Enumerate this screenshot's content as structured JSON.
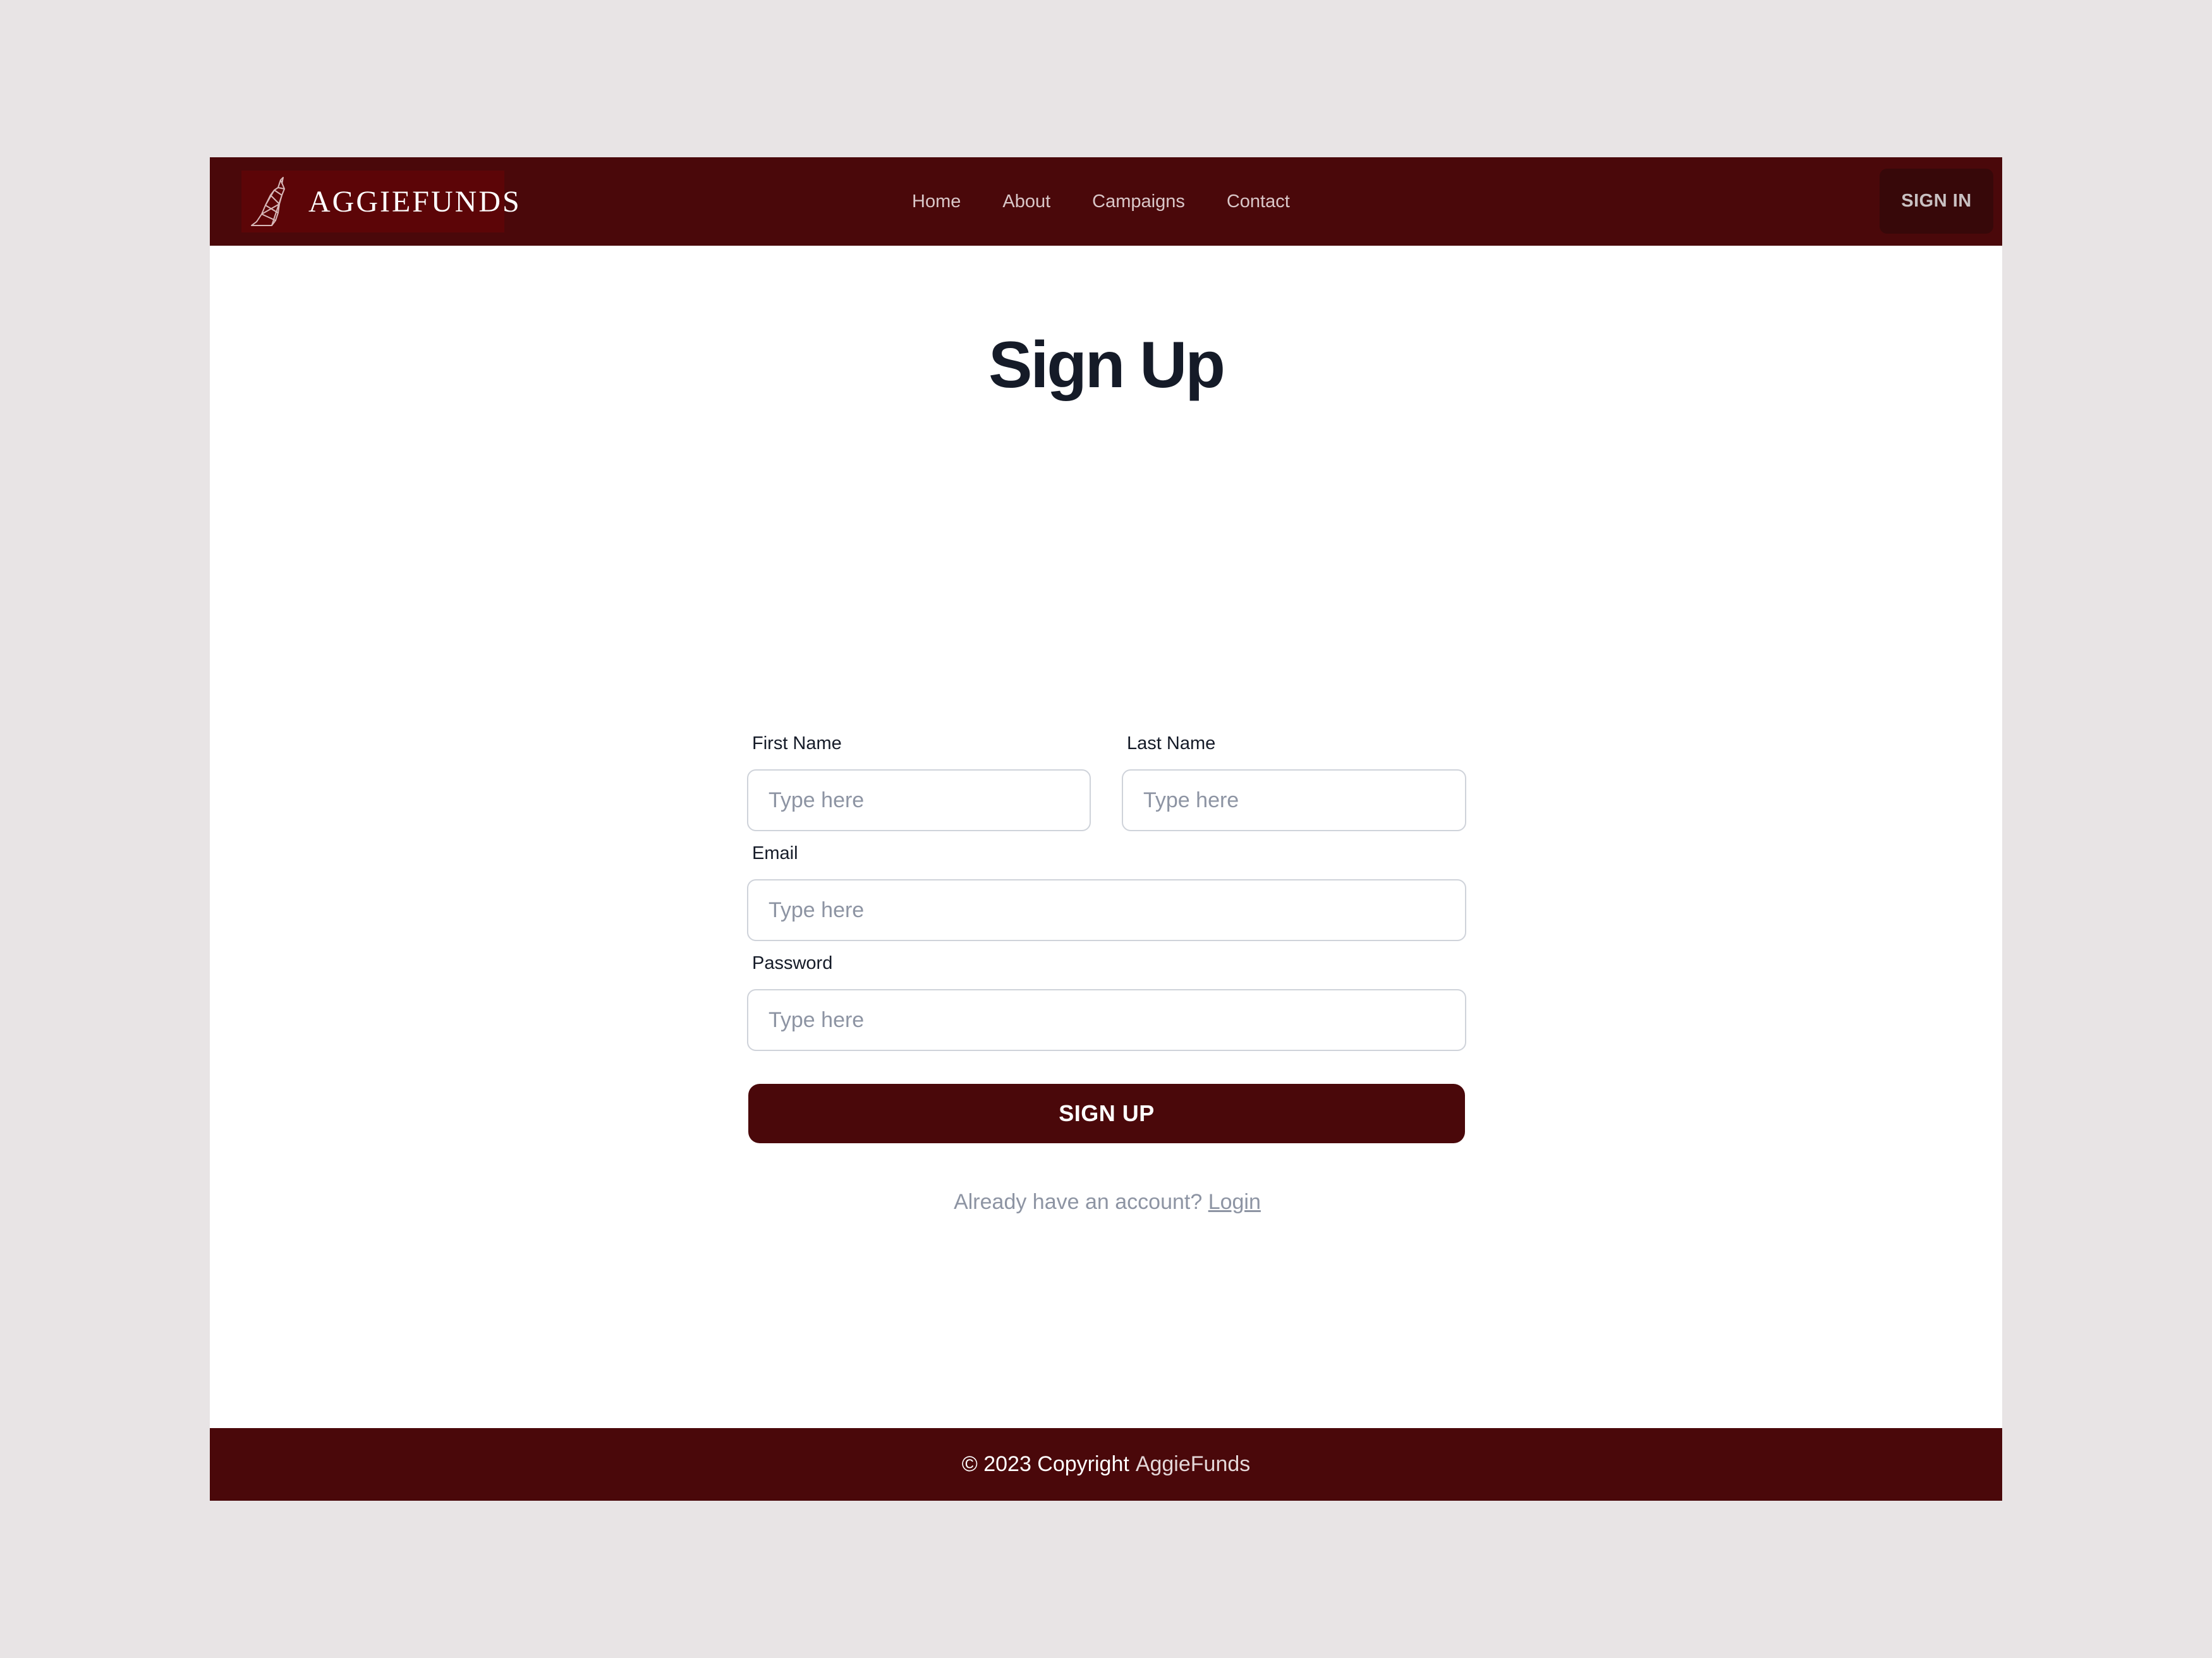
{
  "header": {
    "brand": "AGGIEFUNDS",
    "logo_icon": "howling-dog-icon",
    "nav": [
      "Home",
      "About",
      "Campaigns",
      "Contact"
    ],
    "signin_label": "SIGN IN"
  },
  "main": {
    "title": "Sign Up",
    "fields": {
      "first_name": {
        "label": "First Name",
        "placeholder": "Type here",
        "value": ""
      },
      "last_name": {
        "label": "Last Name",
        "placeholder": "Type here",
        "value": ""
      },
      "email": {
        "label": "Email",
        "placeholder": "Type here",
        "value": ""
      },
      "password": {
        "label": "Password",
        "placeholder": "Type here",
        "value": ""
      }
    },
    "submit_label": "SIGN UP",
    "login_prompt": "Already have an account?",
    "login_link": "Login"
  },
  "footer": {
    "copyright": "© 2023 Copyright",
    "brand": "AggieFunds"
  },
  "colors": {
    "brand": "#4a080a",
    "background": "#e8e4e5",
    "title": "#151b28"
  }
}
